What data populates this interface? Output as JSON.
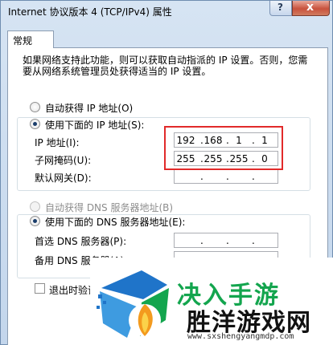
{
  "window": {
    "title": "Internet 协议版本 4 (TCP/IPv4) 属性",
    "help_icon": "?",
    "close_icon": "x"
  },
  "tabs": [
    {
      "label": "常规"
    }
  ],
  "description": "如果网络支持此功能，则可以获取自动指派的 IP 设置。否则，您需要从网络系统管理员处获得适当的 IP 设置。",
  "ip_section": {
    "auto_label": "自动获得 IP 地址(O)",
    "manual_label": "使用下面的 IP 地址(S):",
    "selected": "manual",
    "fields": [
      {
        "label": "IP 地址(I):",
        "octets": [
          "192",
          "168",
          "1",
          "1"
        ]
      },
      {
        "label": "子网掩码(U):",
        "octets": [
          "255",
          "255",
          "255",
          "0"
        ]
      },
      {
        "label": "默认网关(D):",
        "octets": [
          "",
          "",
          "",
          ""
        ]
      }
    ]
  },
  "dns_section": {
    "auto_label": "自动获得 DNS 服务器地址(B)",
    "manual_label": "使用下面的 DNS 服务器地址(E):",
    "selected": "manual",
    "fields": [
      {
        "label": "首选 DNS 服务器(P):",
        "octets": [
          "",
          "",
          "",
          ""
        ]
      },
      {
        "label": "备用 DNS 服务器(A):",
        "octets": [
          "",
          "",
          "",
          ""
        ]
      }
    ]
  },
  "validate_checkbox": {
    "label": "退出时验证",
    "checked": false
  },
  "watermark": {
    "top_text": "决入手游",
    "name": "胜洋游戏网",
    "url": "www.sxshengyangmdp.com"
  },
  "colors": {
    "highlight_border": "#e12a2a",
    "brand_green": "#13a54e",
    "brand_blue": "#1f74c9"
  }
}
